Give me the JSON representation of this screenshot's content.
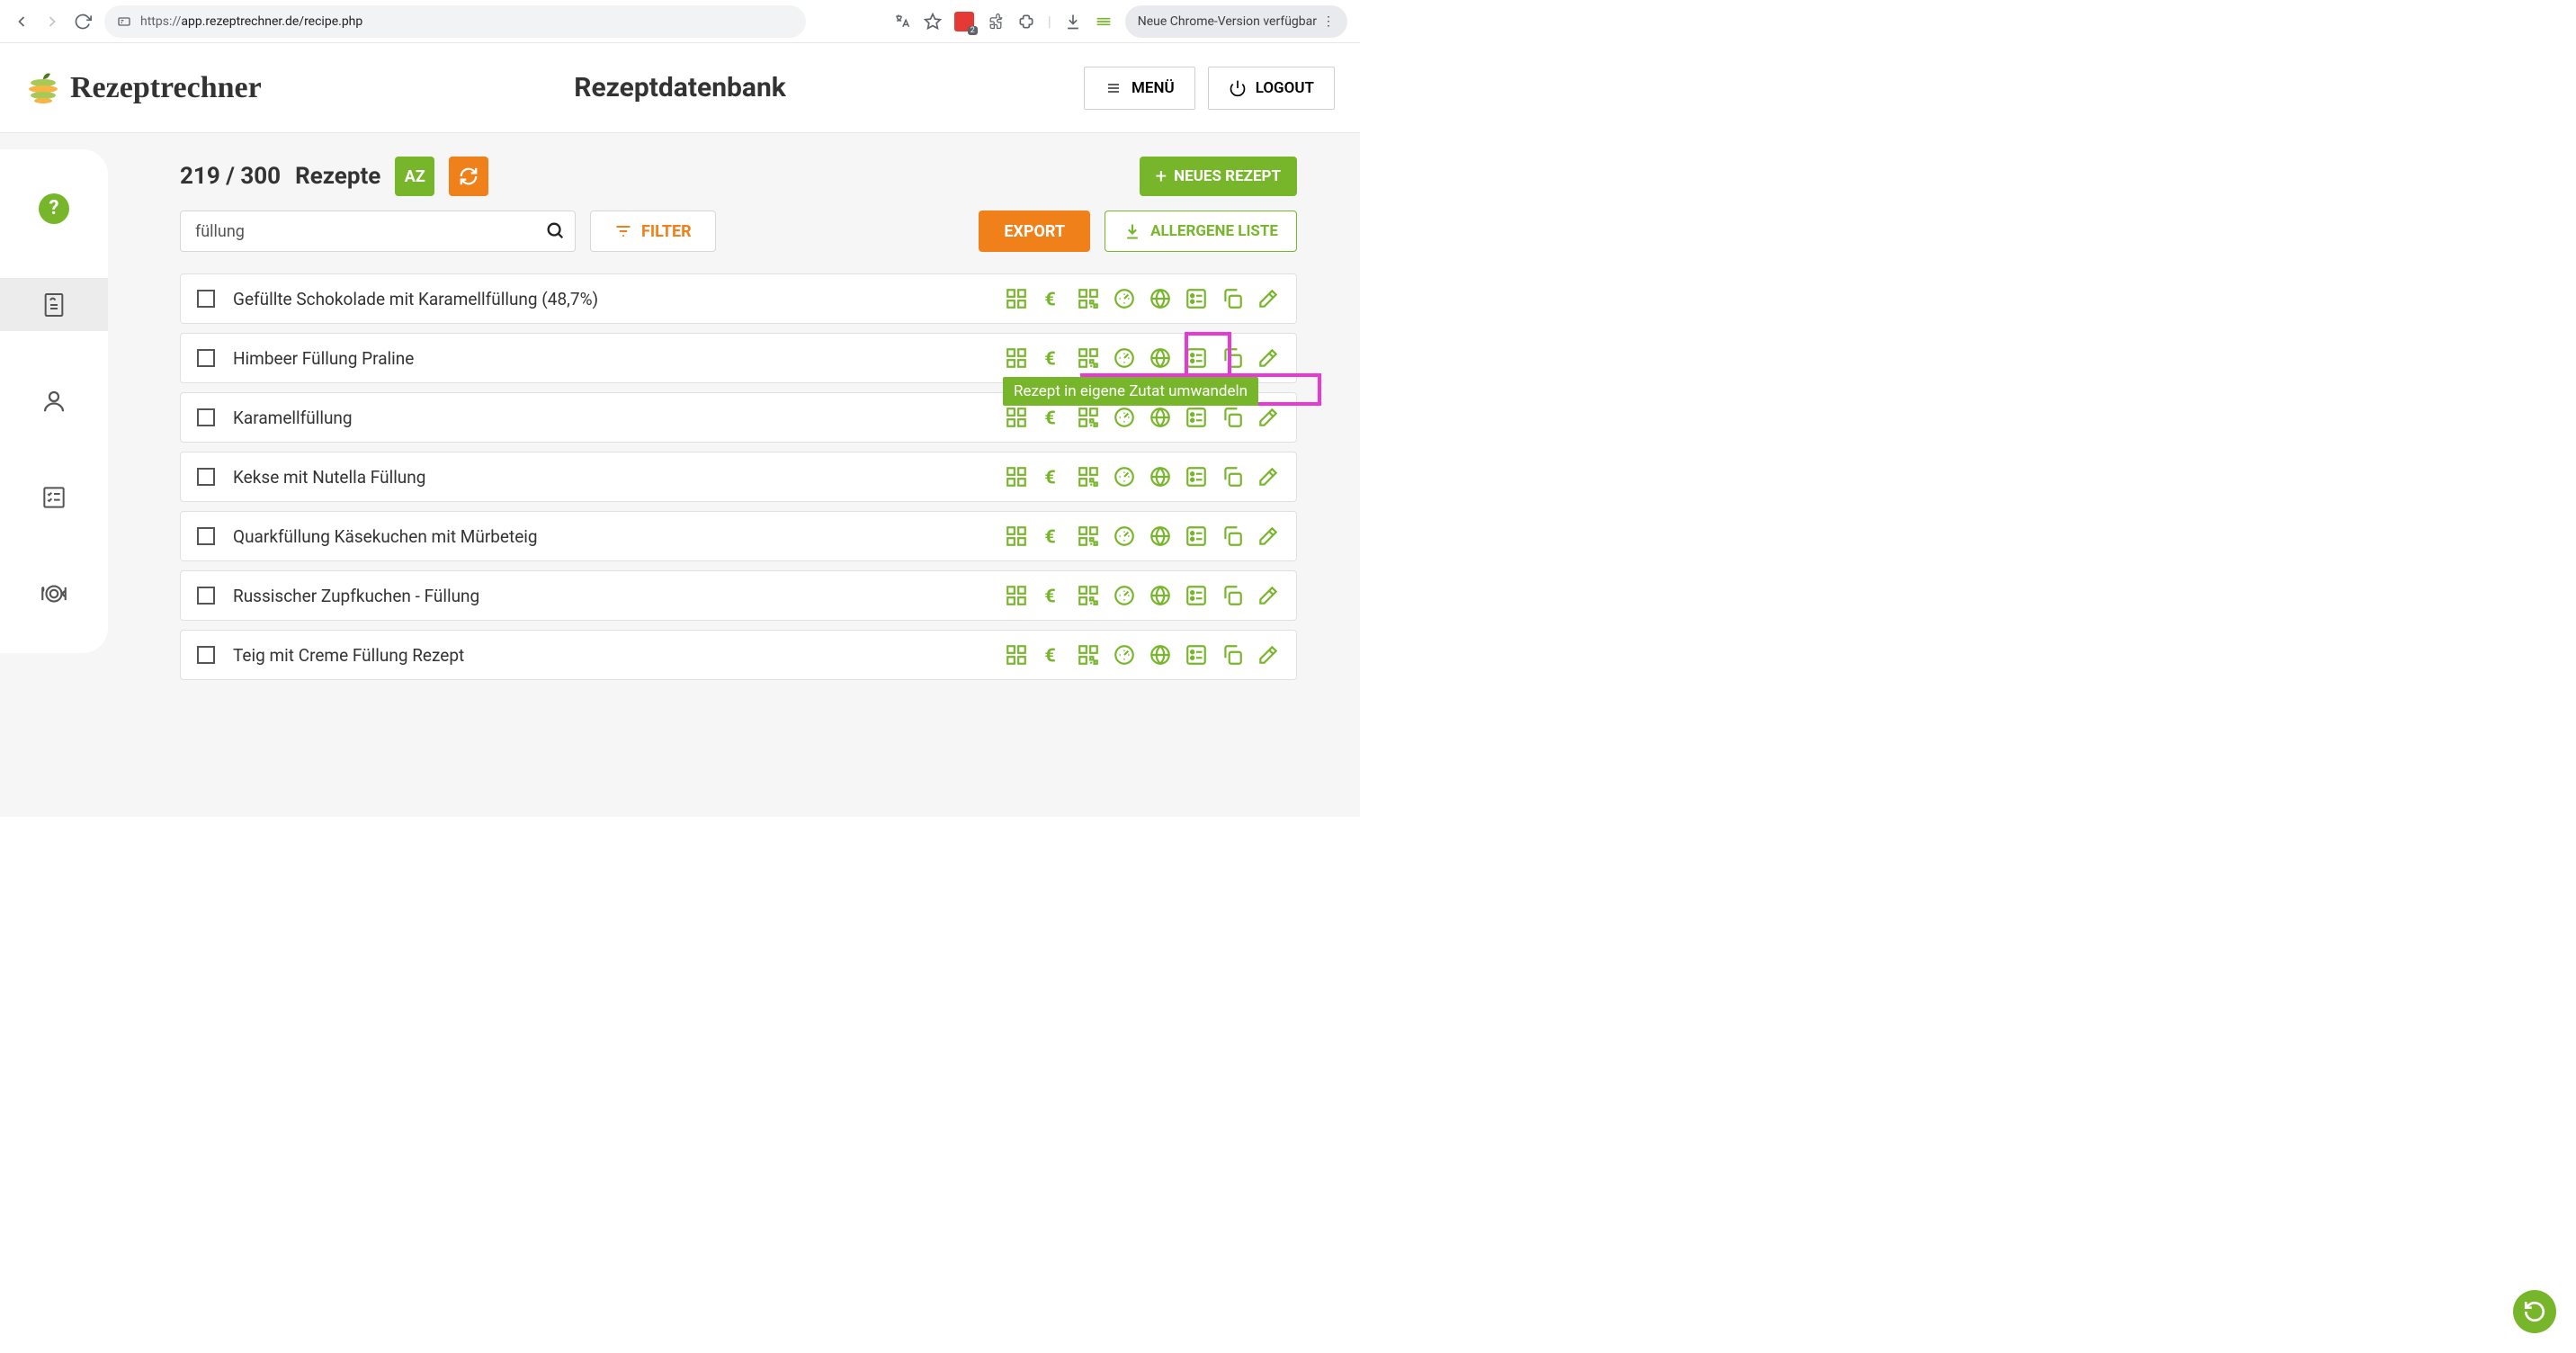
{
  "browser": {
    "url_protocol": "https://",
    "url_rest": "app.rezeptrechner.de/recipe.php",
    "update_text": "Neue Chrome-Version verfügbar",
    "ext_badge_count": "2"
  },
  "header": {
    "brand": "Rezeptrechner",
    "page_title": "Rezeptdatenbank",
    "menu_label": "MENÜ",
    "logout_label": "LOGOUT"
  },
  "toolbar": {
    "count": "219 / 300",
    "unit_label": "Rezepte",
    "sort_label": "AZ",
    "new_recipe": "NEUES REZEPT",
    "search_value": "füllung",
    "filter_label": "FILTER",
    "export_label": "EXPORT",
    "allergen_label": "ALLERGENE LISTE"
  },
  "tooltip": {
    "convert": "Rezept in eigene Zutat umwandeln"
  },
  "row_icons": [
    "grid-icon",
    "euro-icon",
    "qr-icon",
    "meter-icon",
    "globe-icon",
    "list-convert-icon",
    "copy-icon",
    "edit-icon"
  ],
  "recipes": [
    {
      "name": "Gefüllte Schokolade mit Karamellfüllung (48,7%)"
    },
    {
      "name": "Himbeer Füllung Praline",
      "tooltip": true
    },
    {
      "name": "Karamellfüllung"
    },
    {
      "name": "Kekse mit Nutella Füllung"
    },
    {
      "name": "Quarkfüllung Käsekuchen mit Mürbeteig"
    },
    {
      "name": "Russischer Zupfkuchen - Füllung"
    },
    {
      "name": "Teig mit Creme Füllung Rezept"
    }
  ]
}
